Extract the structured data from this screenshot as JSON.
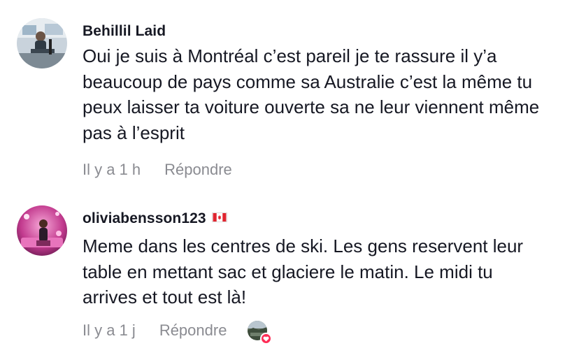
{
  "comments": [
    {
      "username": "Behillil Laid",
      "text": "Oui je suis à Montréal c’est pareil je te rassure il y’a beaucoup de pays comme sa Australie c’est la même tu peux laisser ta voiture ouverte sa ne leur viennent même pas à l’esprit",
      "time": "Il y a 1 h",
      "reply_label": "Répondre",
      "avatar_icon": "user-photo-gym"
    },
    {
      "username": "oliviabensson123",
      "flag_icon": "canada-flag-icon",
      "text": "Meme dans les centres de ski. Les gens reservent leur table en mettant sac et glaciere le matin. Le midi tu arrives et tout est là!",
      "time": "Il y a 1 j",
      "reply_label": "Répondre",
      "avatar_icon": "user-photo-neon",
      "liked_by_creator_icon": "creator-liked-heart-icon"
    }
  ],
  "colors": {
    "text": "#161823",
    "meta": "#8a8b91",
    "heart": "#fe2c55"
  }
}
